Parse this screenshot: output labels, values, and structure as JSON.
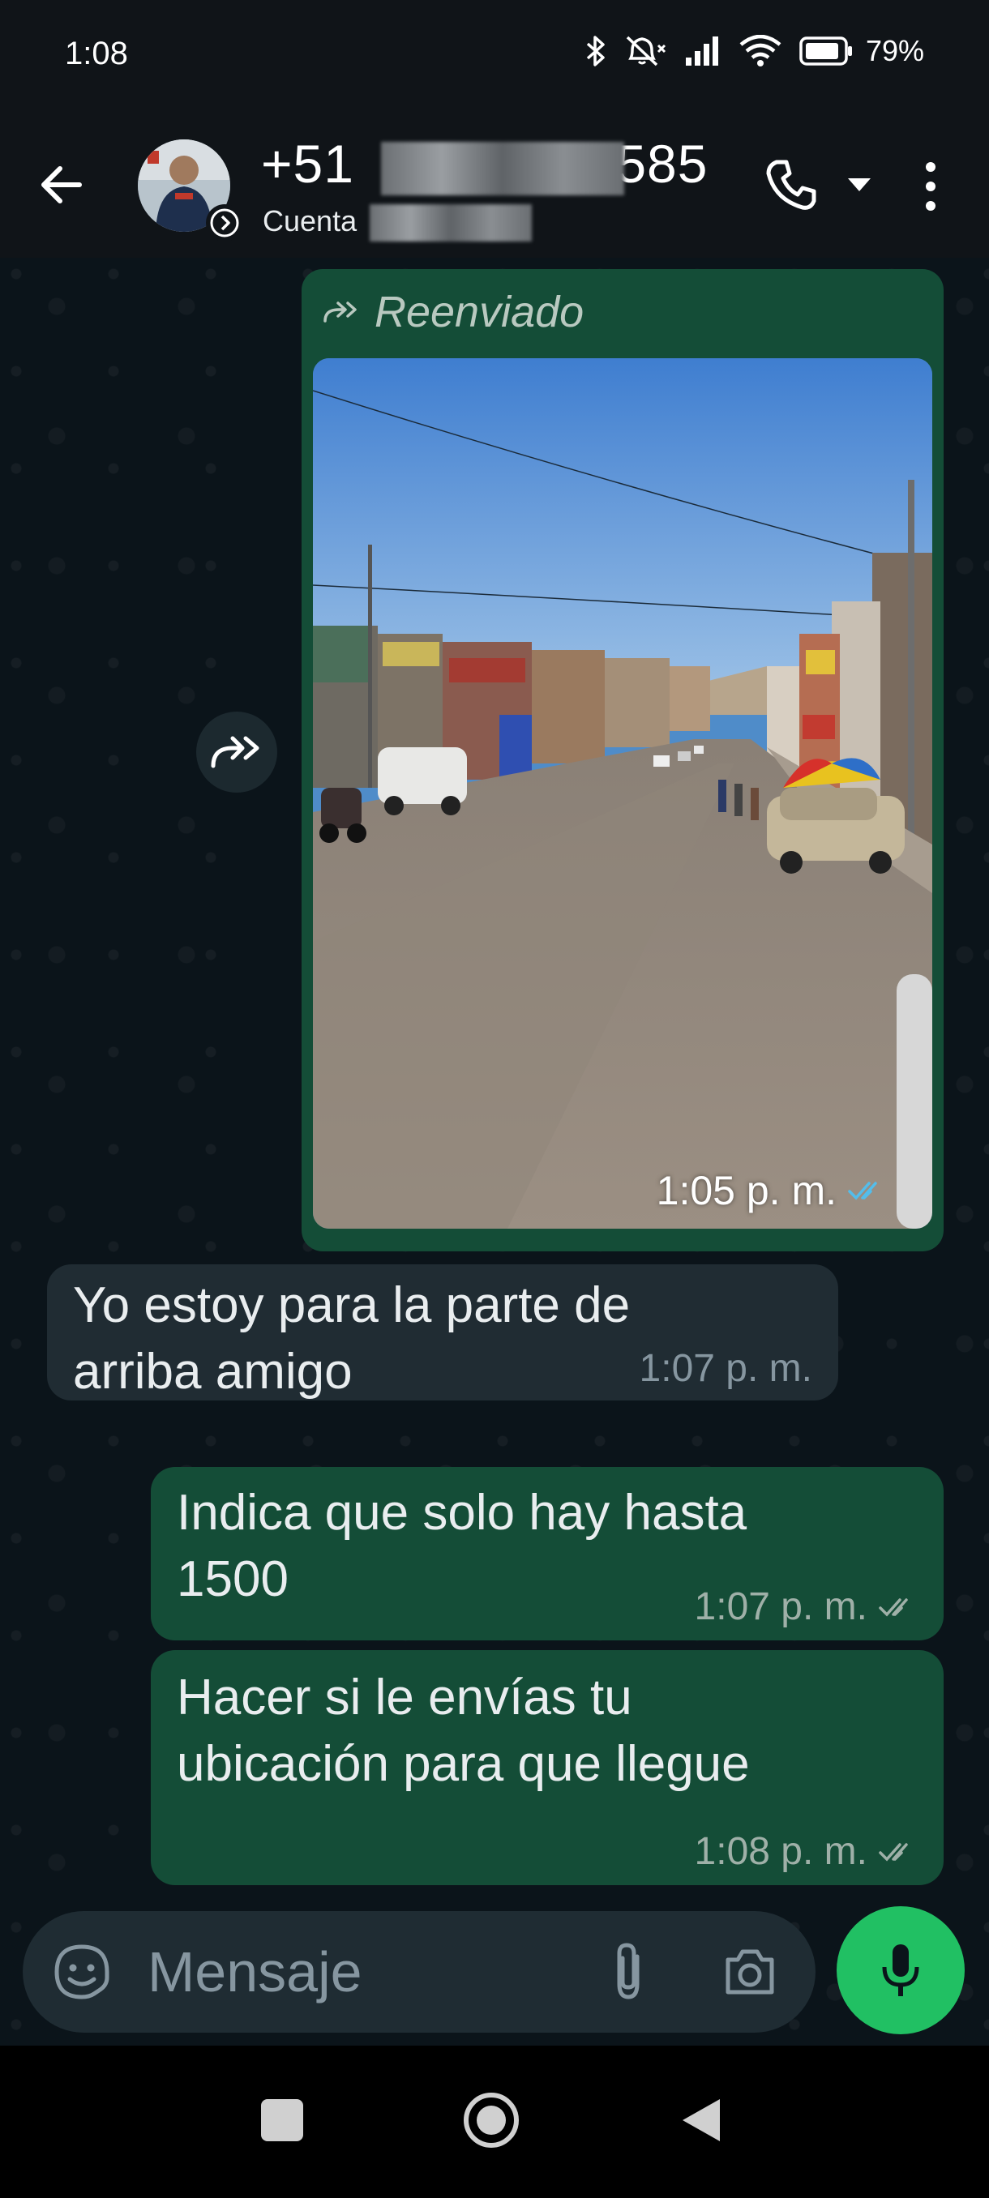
{
  "status_bar": {
    "time": "1:08",
    "battery": "79%"
  },
  "header": {
    "contact_name_prefix": "+51",
    "contact_name_suffix": "585",
    "subtitle_prefix": "Cuenta"
  },
  "messages": {
    "forwarded": {
      "label": "Reenviado",
      "time": "1:05 p. m.",
      "status": "read"
    },
    "incoming_1": {
      "text": "Yo estoy para la parte de\narriba amigo",
      "time": "1:07 p. m."
    },
    "outgoing_1": {
      "text": "Indica que solo hay hasta\n1500",
      "time": "1:07 p. m.",
      "status": "delivered"
    },
    "outgoing_2": {
      "text": "Hacer si le envías tu\nubicación para que llegue",
      "time": "1:08 p. m.",
      "status": "delivered"
    }
  },
  "composer": {
    "placeholder": "Mensaje"
  },
  "colors": {
    "outgoing_bubble": "#144d37",
    "incoming_bubble": "#202c33",
    "mic_button": "#21c063",
    "read_ticks": "#53bdeb"
  },
  "icons": {
    "back": "arrow-left-icon",
    "call": "phone-icon",
    "menu": "more-vert-icon",
    "forward": "forward-icon",
    "emoji": "sticker-icon",
    "attach": "paperclip-icon",
    "camera": "camera-icon",
    "mic": "mic-icon"
  }
}
